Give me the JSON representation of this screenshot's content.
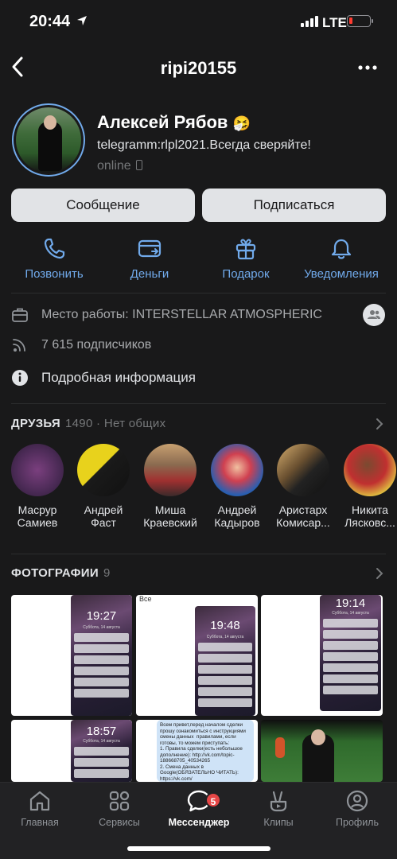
{
  "status_bar": {
    "time": "20:44",
    "network": "LTE"
  },
  "header": {
    "title": "ripi20155"
  },
  "profile": {
    "name": "Алексей Рябов",
    "name_emoji": "🤧",
    "status": "telegramm:rlpl2021.Всегда сверяйте!",
    "online": "online"
  },
  "buttons": {
    "message": "Сообщение",
    "subscribe": "Подписаться"
  },
  "actions": [
    {
      "label": "Позвонить",
      "icon": "phone-icon"
    },
    {
      "label": "Деньги",
      "icon": "money-transfer-icon"
    },
    {
      "label": "Подарок",
      "icon": "gift-icon"
    },
    {
      "label": "Уведомления",
      "icon": "bell-icon"
    }
  ],
  "info": {
    "work": "Место работы: INTERSTELLAR ATMOSPHERIC",
    "followers": "7 615 подписчиков",
    "details": "Подробная информация"
  },
  "friends": {
    "title": "ДРУЗЬЯ",
    "count": "1490",
    "extra": " · Нет общих",
    "items": [
      {
        "name1": "Масрур",
        "name2": "Самиев"
      },
      {
        "name1": "Андрей",
        "name2": "Фаст"
      },
      {
        "name1": "Миша",
        "name2": "Краевский"
      },
      {
        "name1": "Андрей",
        "name2": "Кадыров"
      },
      {
        "name1": "Аристарх",
        "name2": "Комисар..."
      },
      {
        "name1": "Никита",
        "name2": "Лясковс..."
      }
    ]
  },
  "photos": {
    "title": "ФОТОГРАФИИ",
    "count": "9",
    "lock_times": [
      "19:27",
      "19:48",
      "19:14",
      "18:57"
    ],
    "lock_date": "Суббота, 14 августа",
    "chat_header": "Все",
    "chat_text": "Всем привет,перед началом сделки прошу ознакомиться с инструкциями смены данных  правилами, если готовы, то можем приступать:\n1. Правила сделки(есть небольшое дополнение): http://vk.com/topic-188668705_40534265\n2. Смена данных в Google(ОБЯЗАТЕЛЬНО ЧИТАТЬ): https://vk.com/"
  },
  "tabbar": [
    {
      "label": "Главная",
      "icon": "home-icon"
    },
    {
      "label": "Сервисы",
      "icon": "services-icon"
    },
    {
      "label": "Мессенджер",
      "icon": "messenger-icon",
      "badge": "5"
    },
    {
      "label": "Клипы",
      "icon": "clips-icon"
    },
    {
      "label": "Профиль",
      "icon": "profile-icon"
    }
  ],
  "colors": {
    "accent": "#71aaeb",
    "background": "#19191a",
    "online_badge": "#4bb34b",
    "notification_badge": "#e64646"
  }
}
